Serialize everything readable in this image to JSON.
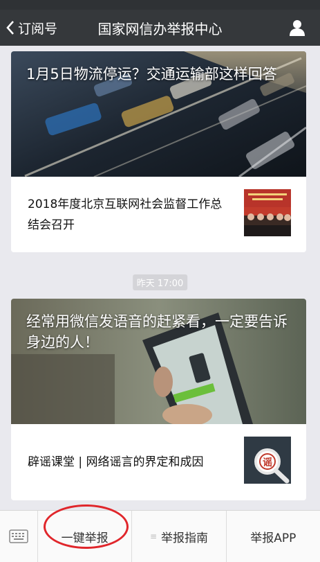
{
  "nav": {
    "back_label": "订阅号",
    "title": "国家网信办举报中心",
    "back_icon": "chevron-left-icon",
    "user_icon": "user-icon"
  },
  "top_card": {
    "cover_title": "1月5日物流停运？交通运输部这样回答",
    "sub_title": "2018年度北京互联网社会监督工作总结会召开"
  },
  "timestamp": "昨天 17:00",
  "bottom_card": {
    "cover_title": "经常用微信发语音的赶紧看，一定要告诉身边的人！",
    "sub_title": "辟谣课堂 | 网络谣言的界定和成因",
    "thumb_text": "谣"
  },
  "menu": {
    "keyboard_icon": "keyboard-icon",
    "items": [
      {
        "label": "一键举报"
      },
      {
        "label": "举报指南",
        "icon": "menu-lines-icon"
      },
      {
        "label": "举报APP"
      }
    ]
  },
  "colors": {
    "navbar": "#35383b",
    "annotation": "#e0262b",
    "background": "#e9e9ee"
  }
}
